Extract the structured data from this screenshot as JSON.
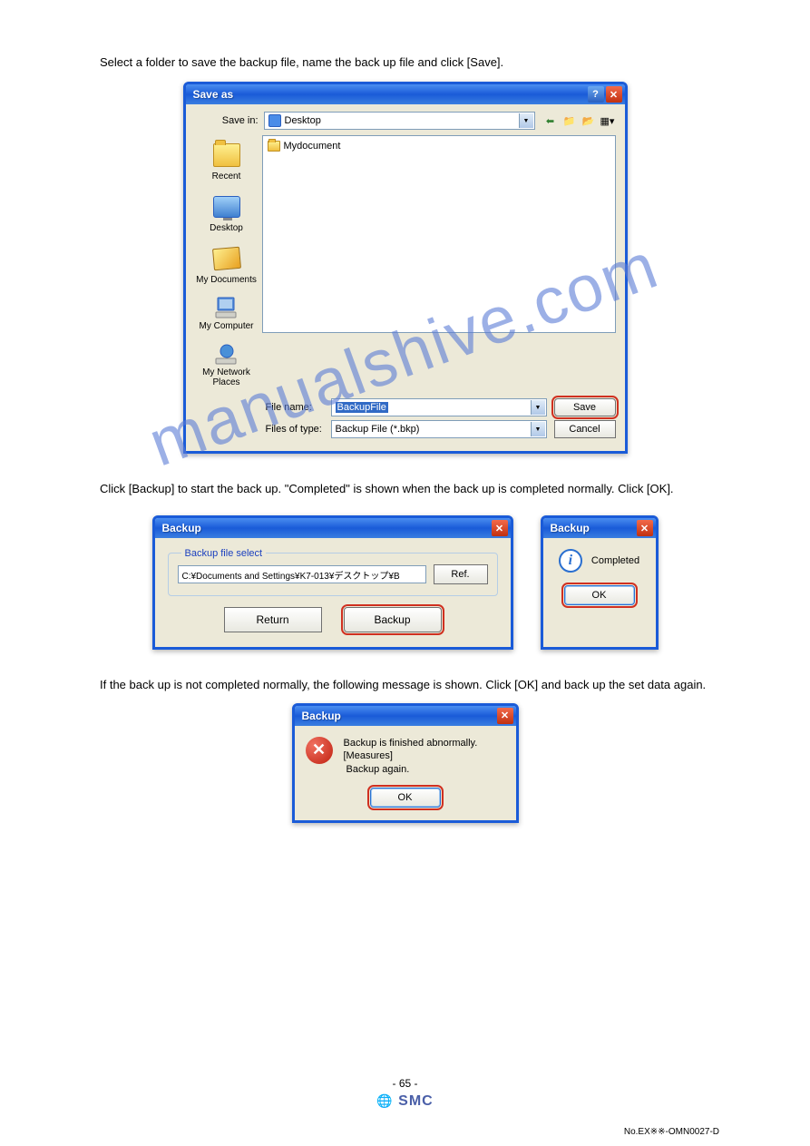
{
  "instructions": {
    "line1": "Select a folder to save the backup file, name the back up file and click [Save].",
    "line2": "Click [Backup] to start the back up. \"Completed\" is shown when the back up is completed normally. Click [OK].",
    "line3": "If the back up is not completed normally, the following message is shown. Click [OK] and back up the set data again."
  },
  "saveas": {
    "title": "Save as",
    "save_in_label": "Save in:",
    "save_in_value": "Desktop",
    "file_item": "Mydocument",
    "places": {
      "recent": "Recent",
      "desktop": "Desktop",
      "mydocs": "My Documents",
      "mycomp": "My Computer",
      "netplaces": "My Network Places"
    },
    "filename_label": "File name:",
    "filename_value": "BackupFile",
    "filetype_label": "Files of type:",
    "filetype_value": "Backup File (*.bkp)",
    "save_btn": "Save",
    "cancel_btn": "Cancel"
  },
  "backup_select": {
    "title": "Backup",
    "legend": "Backup file select",
    "path": "C:¥Documents and Settings¥K7-013¥デスクトップ¥B",
    "ref_btn": "Ref.",
    "return_btn": "Return",
    "backup_btn": "Backup"
  },
  "completed": {
    "title": "Backup",
    "text": "Completed",
    "ok": "OK"
  },
  "abnormal": {
    "title": "Backup",
    "line1": "Backup is finished abnormally.",
    "line2": "[Measures]",
    "line3": " Backup again.",
    "ok": "OK"
  },
  "watermark": "manualshive.com",
  "footer": {
    "page": "- 65 -",
    "logo": "SMC",
    "num": "No.EX※※-OMN0027-D"
  }
}
